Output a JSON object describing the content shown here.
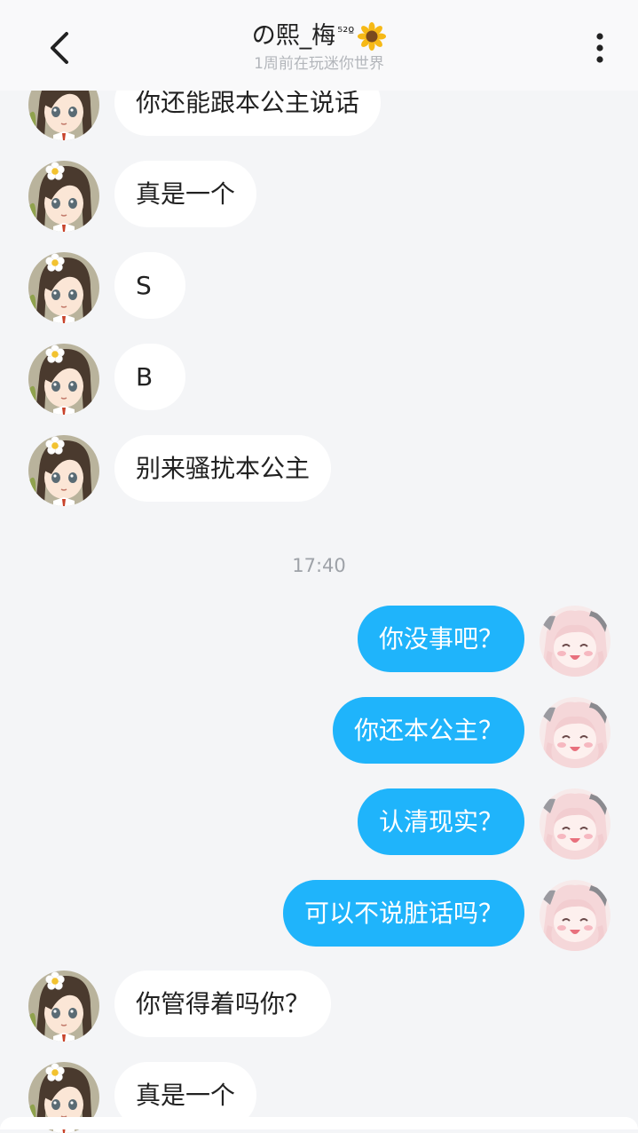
{
  "header": {
    "title": "の熙_梅",
    "title_suffix": "⁵²º",
    "status": "1周前在玩迷你世界"
  },
  "colors": {
    "outgoing_bubble": "#1fb4fb",
    "incoming_bubble": "#ffffff",
    "background": "#f4f5f7"
  },
  "messages": [
    {
      "side": "in",
      "text": "你还能跟本公主说话"
    },
    {
      "side": "in",
      "text": "真是一个"
    },
    {
      "side": "in",
      "text": "S"
    },
    {
      "side": "in",
      "text": "B"
    },
    {
      "side": "in",
      "text": "别来骚扰本公主"
    },
    {
      "side": "out",
      "text": "你没事吧？"
    },
    {
      "side": "out",
      "text": "你还本公主？"
    },
    {
      "side": "out",
      "text": "认清现实？"
    },
    {
      "side": "out",
      "text": "可以不说脏话吗？"
    },
    {
      "side": "in",
      "text": "你管得着吗你？"
    },
    {
      "side": "in",
      "text": "真是一个"
    }
  ],
  "timestamp": "17:40"
}
